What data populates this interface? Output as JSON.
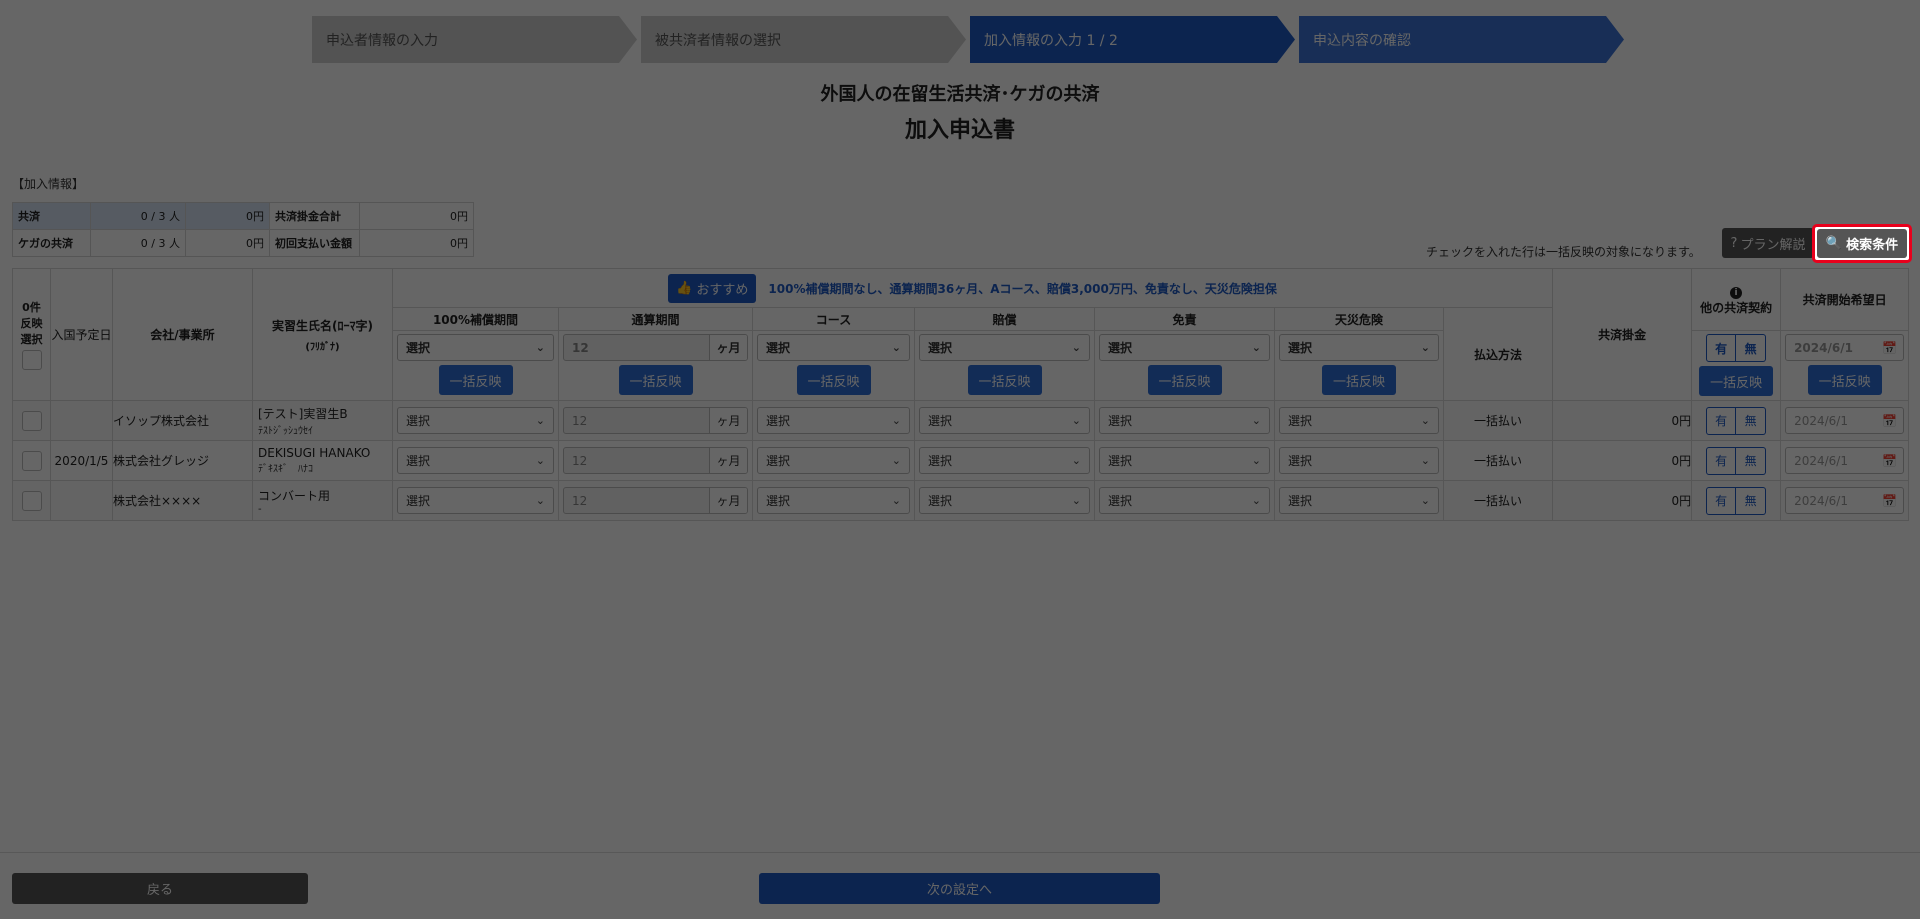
{
  "steps": [
    {
      "label": "申込者情報の入力"
    },
    {
      "label": "被共済者情報の選択"
    },
    {
      "label": "加入情報の入力 1 / 2"
    },
    {
      "label": "申込内容の確認"
    }
  ],
  "title": "外国人の在留生活共済･ケガの共済",
  "subtitle": "加入申込書",
  "info_label": "【加入情報】",
  "summary": {
    "row1": {
      "label": "共済",
      "count": "0 / 3 人",
      "amount": "0円",
      "label2": "共済掛金合計",
      "value2": "0円"
    },
    "row2": {
      "label": "ケガの共済",
      "count": "0 / 3 人",
      "amount": "0円",
      "label2": "初回支払い金額",
      "value2": "0円"
    }
  },
  "note": "チェックを入れた行は一括反映の対象になります。",
  "plan_button": "プラン解説",
  "search_button": "検索条件",
  "table": {
    "select_header": {
      "count": "0件",
      "label1": "反映",
      "label2": "選択"
    },
    "entry_date_header": "入国予定日",
    "company_header": "会社/事業所",
    "name_header": "実習生氏名(ﾛｰﾏ字)",
    "name_header_kana": "(ﾌﾘｶﾞﾅ)",
    "recommend_button": "おすすめ",
    "recommend_text": "100%補償期間なし、通算期間36ヶ月、Aコース、賠償3,000万円、免責なし、天災危険担保",
    "col_coverage": "100%補償期間",
    "col_period": "通算期間",
    "col_course": "コース",
    "col_liability": "賠償",
    "col_deductible": "免責",
    "col_disaster": "天災危険",
    "col_payment": "払込方法",
    "col_premium": "共済掛金",
    "col_other": "他の共済契約",
    "col_start": "共済開始希望日",
    "select_placeholder": "選択",
    "period_value": "12",
    "period_unit": "ヶ月",
    "bulk_button": "一括反映",
    "yes": "有",
    "no": "無",
    "date_placeholder": "2024/6/1",
    "rows": [
      {
        "entry_date": "",
        "company": "イソップ株式会社",
        "name": "[テスト]実習生B",
        "kana": "ﾃｽﾄｼﾞｯｼｭｳｾｲ",
        "payment": "一括払い",
        "premium": "0円"
      },
      {
        "entry_date": "2020/1/5",
        "company": "株式会社グレッジ",
        "name": "DEKISUGI HANAKO",
        "kana": "ﾃﾞｷｽｷﾞ　ﾊﾅｺ",
        "payment": "一括払い",
        "premium": "0円"
      },
      {
        "entry_date": "",
        "company": "株式会社××××",
        "name": "コンバート用",
        "kana": "-",
        "payment": "一括払い",
        "premium": "0円"
      }
    ]
  },
  "back_button": "戻る",
  "next_button": "次の設定へ"
}
